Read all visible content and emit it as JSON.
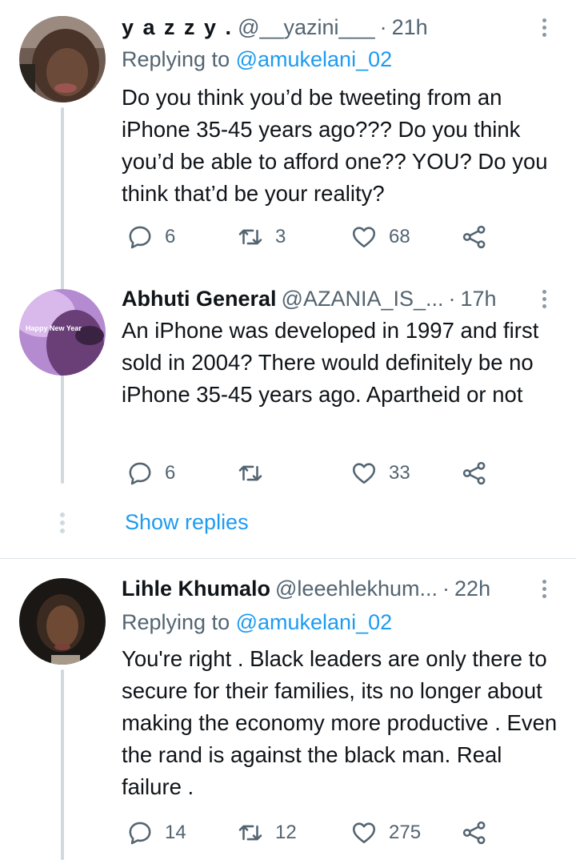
{
  "tweets": [
    {
      "name": "y a z z y .",
      "handle": "@__yazini___",
      "separator": "·",
      "time": "21h",
      "replying_label": "Replying to ",
      "replying_to": "@amukelani_02",
      "text": "Do you think you’d be tweeting from an iPhone 35-45 years ago??? Do you think you’d be able to afford one?? YOU? Do you think that’d be your reality?",
      "replies": "6",
      "retweets": "3",
      "likes": "68"
    },
    {
      "name": "Abhuti General",
      "handle": "@AZANIA_IS_...",
      "separator": "·",
      "time": "17h",
      "avatar_text": "Happy New Year",
      "text": "An iPhone was developed in 1997 and first sold in 2004? There would definitely be no iPhone 35-45 years ago. Apartheid or not",
      "replies": "6",
      "retweets": "",
      "likes": "33"
    },
    {
      "name": "Lihle Khumalo",
      "handle": "@leeehlekhum...",
      "separator": "·",
      "time": "22h",
      "replying_label": "Replying to ",
      "replying_to": "@amukelani_02",
      "text": "You're right . Black leaders are only there to secure for their families, its no longer about making the economy more productive . Even the rand is against the black man. Real failure .",
      "replies": "14",
      "retweets": "12",
      "likes": "275"
    }
  ],
  "show_replies": "Show replies",
  "colors": {
    "accent": "#1d9bf0",
    "secondary_text": "#536471",
    "thread_line": "#cfd9de"
  },
  "icons": [
    "reply-icon",
    "retweet-icon",
    "like-icon",
    "share-icon",
    "more-icon"
  ]
}
